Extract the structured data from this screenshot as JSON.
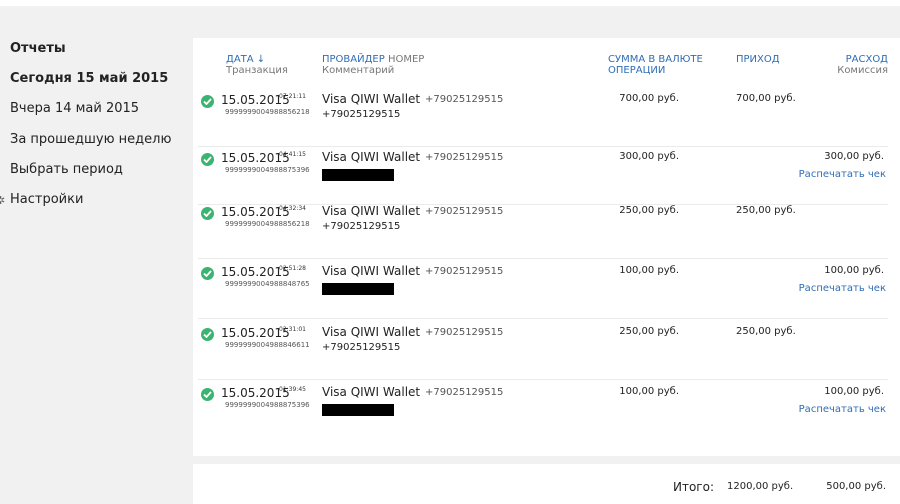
{
  "sidebar": {
    "items": [
      {
        "label": "Отчеты",
        "bold": true
      },
      {
        "label": "Сегодня 15 май 2015",
        "bold": true
      },
      {
        "label": "Вчера 14 май 2015",
        "bold": false
      },
      {
        "label": "За прошедшую неделю",
        "bold": false
      },
      {
        "label": "Выбрать период",
        "bold": false
      },
      {
        "label": "Настройки",
        "bold": false
      }
    ]
  },
  "headers": {
    "date": "ДАТА ↓",
    "transaction": "Транзакция",
    "provider": "ПРОВАЙДЕР",
    "number": "НОМЕР",
    "comment": "Комментарий",
    "amount_line1": "СУММА В ВАЛЮТЕ",
    "amount_line2": "ОПЕРАЦИИ",
    "income": "ПРИХОД",
    "expense": "РАСХОД",
    "commission": "Комиссия"
  },
  "rows": [
    {
      "date": "15.05.2015",
      "time": "07:21:11",
      "txid": "9999999004988856218",
      "provider": "Visa QIWI Wallet",
      "number": "+79025129515",
      "comment": "+79025129515",
      "redacted": false,
      "amount": "700,00 руб.",
      "income": "700,00 руб.",
      "expense": "",
      "print": ""
    },
    {
      "date": "15.05.2015",
      "time": "04:41:15",
      "txid": "9999999004988875396",
      "provider": "Visa QIWI Wallet",
      "number": "+79025129515",
      "comment": "",
      "redacted": true,
      "amount": "300,00 руб.",
      "income": "",
      "expense": "300,00 руб.",
      "print": "Распечатать чек"
    },
    {
      "date": "15.05.2015",
      "time": "04:32:34",
      "txid": "9999999004988856218",
      "provider": "Visa QIWI Wallet",
      "number": "+79025129515",
      "comment": "+79025129515",
      "redacted": false,
      "amount": "250,00 руб.",
      "income": "250,00 руб.",
      "expense": "",
      "print": ""
    },
    {
      "date": "15.05.2015",
      "time": "02:51:28",
      "txid": "9999999004988848765",
      "provider": "Visa QIWI Wallet",
      "number": "+79025129515",
      "comment": "",
      "redacted": true,
      "amount": "100,00 руб.",
      "income": "",
      "expense": "100,00 руб.",
      "print": "Распечатать чек"
    },
    {
      "date": "15.05.2015",
      "time": "02:31:01",
      "txid": "9999999004988846611",
      "provider": "Visa QIWI Wallet",
      "number": "+79025129515",
      "comment": "+79025129515",
      "redacted": false,
      "amount": "250,00 руб.",
      "income": "250,00 руб.",
      "expense": "",
      "print": ""
    },
    {
      "date": "15.05.2015",
      "time": "01:39:45",
      "txid": "9999999004988875396",
      "provider": "Visa QIWI Wallet",
      "number": "+79025129515",
      "comment": "",
      "redacted": true,
      "amount": "100,00 руб.",
      "income": "",
      "expense": "100,00 руб.",
      "print": "Распечатать чек"
    }
  ],
  "totals": {
    "label": "Итого:",
    "income": "1200,00 руб.",
    "expense": "500,00 руб."
  },
  "colors": {
    "link": "#2f6db5",
    "success": "#3cb371",
    "background": "#f1f1f1"
  }
}
